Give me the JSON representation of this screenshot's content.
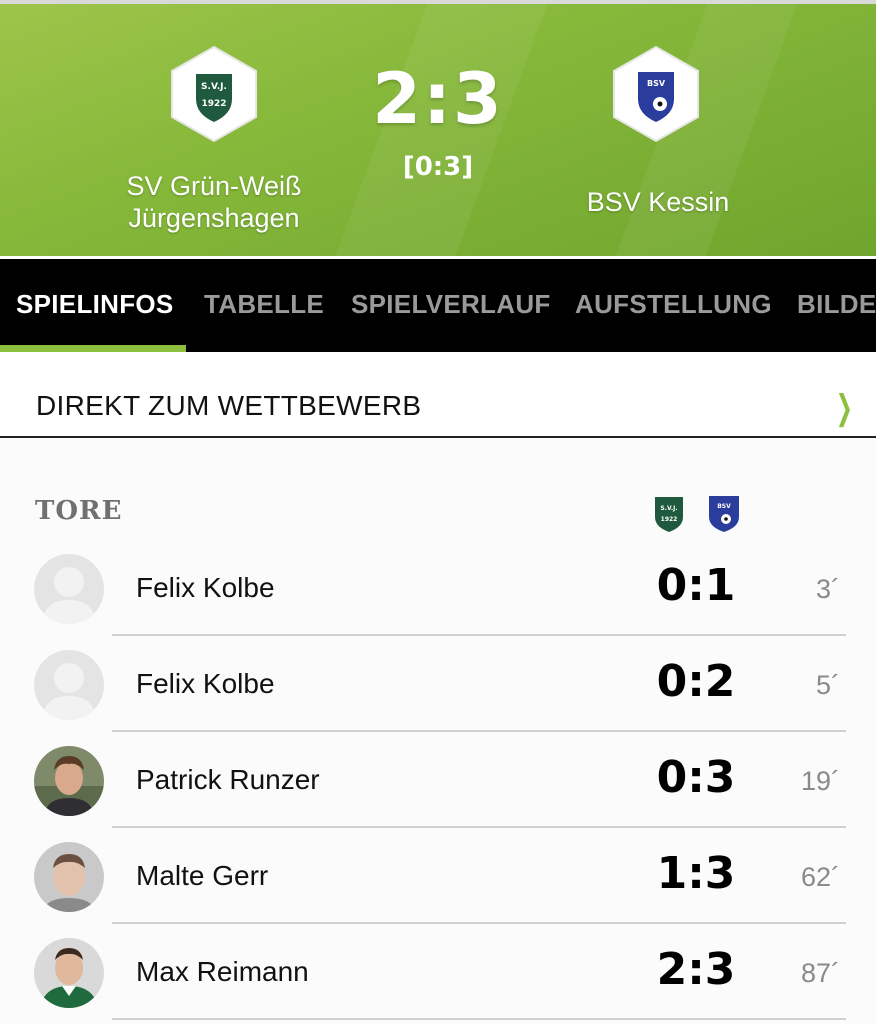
{
  "match": {
    "home_team": {
      "name_line1": "SV Grün-Weiß",
      "name_line2": "Jürgenshagen",
      "logo_text_top": "S.V.J.",
      "logo_text_bottom": "1922"
    },
    "away_team": {
      "name": "BSV Kessin",
      "logo_text": "BSV"
    },
    "score": "2:3",
    "halftime": "[0:3]"
  },
  "tabs": [
    {
      "label": "SPIELINFOS",
      "active": true
    },
    {
      "label": "TABELLE",
      "active": false
    },
    {
      "label": "SPIELVERLAUF",
      "active": false
    },
    {
      "label": "AUFSTELLUNG",
      "active": false
    },
    {
      "label": "BILDER",
      "active": false
    }
  ],
  "direkt": {
    "label": "DIREKT ZUM WETTBEWERB"
  },
  "tore": {
    "title": "TORE",
    "goals": [
      {
        "player": "Felix Kolbe",
        "score": "0:1",
        "minute": "3´",
        "avatar": "placeholder"
      },
      {
        "player": "Felix Kolbe",
        "score": "0:2",
        "minute": "5´",
        "avatar": "placeholder"
      },
      {
        "player": "Patrick Runzer",
        "score": "0:3",
        "minute": "19´",
        "avatar": "photo"
      },
      {
        "player": "Malte Gerr",
        "score": "1:3",
        "minute": "62´",
        "avatar": "photo"
      },
      {
        "player": "Max Reimann",
        "score": "2:3",
        "minute": "87´",
        "avatar": "photo"
      }
    ]
  },
  "colors": {
    "accent_green": "#8dbf3e",
    "header_green": "#86b83a",
    "home_logo_green": "#1f5a3f",
    "away_logo_blue": "#2a3d9c"
  }
}
